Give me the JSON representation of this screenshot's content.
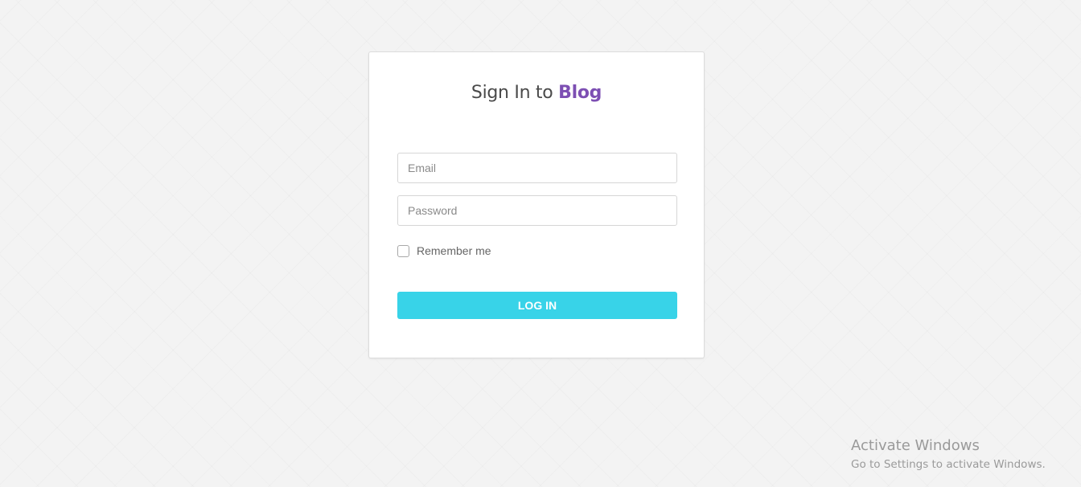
{
  "login_card": {
    "title_prefix": "Sign In to",
    "title_brand": "Blog",
    "email": {
      "placeholder": "Email",
      "value": ""
    },
    "password": {
      "placeholder": "Password",
      "value": ""
    },
    "remember_label": "Remember me",
    "remember_checked": false,
    "login_button": "LOG IN"
  },
  "watermark": {
    "title": "Activate Windows",
    "subtitle": "Go to Settings to activate Windows."
  },
  "colors": {
    "brand": "#7d4fb3",
    "button": "#38d3e8",
    "background": "#f3f3f3"
  }
}
